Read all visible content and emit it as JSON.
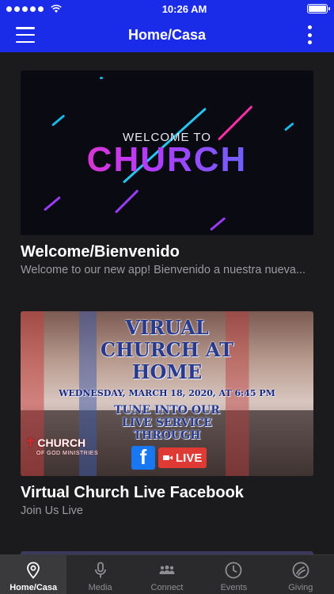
{
  "status_bar": {
    "time": "10:26 AM"
  },
  "nav": {
    "title": "Home/Casa"
  },
  "cards": [
    {
      "title": "Welcome/Bienvenido",
      "subtitle": "Welcome to our new app! Bienvenido a nuestra nueva...",
      "image": {
        "line1": "WELCOME TO",
        "line2": "CHURCH"
      }
    },
    {
      "title": "Virtual Church Live Facebook",
      "subtitle": "Join Us Live",
      "image": {
        "line1": "VIRUAL",
        "line2": "CHURCH AT",
        "line3": "HOME",
        "date": "WEDNESDAY, MARCH 18, 2020, AT 6:45 PM",
        "line4": "TUNE INTO OUR",
        "line5": "LIVE SERVICE",
        "line6": "THROUGH",
        "live": "LIVE",
        "fb": "f",
        "badge": "CHURCH",
        "badge_sub": "OF GOD MINISTRIES"
      }
    }
  ],
  "tabs": [
    {
      "label": "Home/Casa",
      "icon": "location-pin-icon",
      "active": true
    },
    {
      "label": "Media",
      "icon": "microphone-icon",
      "active": false
    },
    {
      "label": "Connect",
      "icon": "group-icon",
      "active": false
    },
    {
      "label": "Events",
      "icon": "clock-icon",
      "active": false
    },
    {
      "label": "Giving",
      "icon": "giving-icon",
      "active": false
    }
  ],
  "colors": {
    "brand_blue": "#1a2ce8",
    "background": "#1b1b1d",
    "tab_bar": "#2a2a2c",
    "subtitle": "#9b9ba0"
  }
}
